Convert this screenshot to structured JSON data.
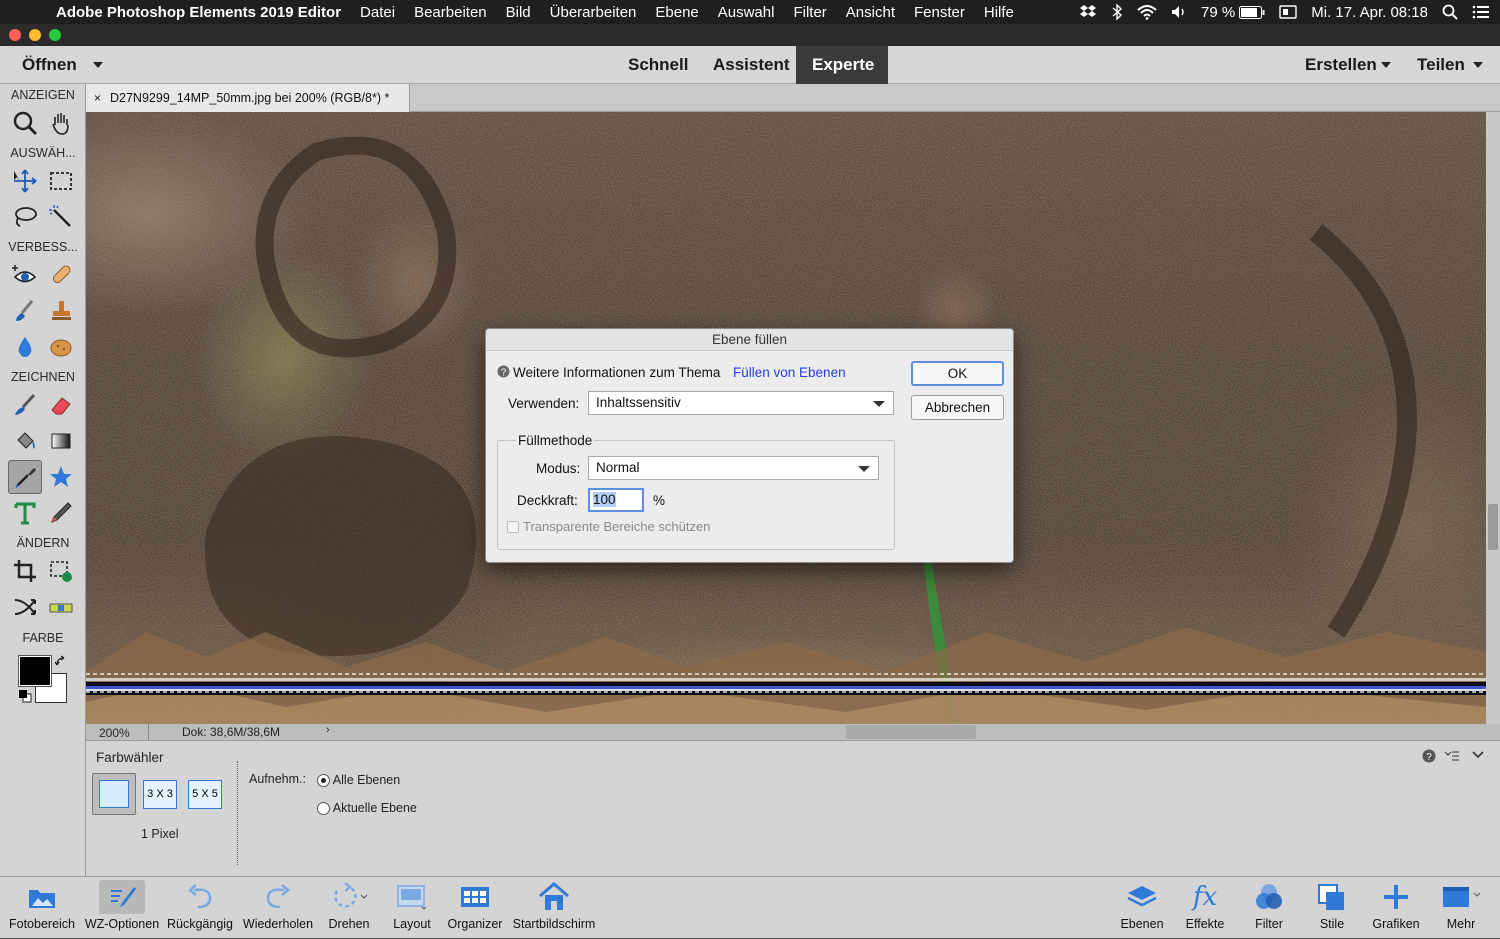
{
  "menubar": {
    "app_name": "Adobe Photoshop Elements 2019 Editor",
    "items": [
      "Datei",
      "Bearbeiten",
      "Bild",
      "Überarbeiten",
      "Ebene",
      "Auswahl",
      "Filter",
      "Ansicht",
      "Fenster",
      "Hilfe"
    ],
    "battery": "79 %",
    "datetime": "Mi. 17. Apr.  08:18"
  },
  "modebar": {
    "open": "Öffnen",
    "modes": [
      "Schnell",
      "Assistent",
      "Experte"
    ],
    "active_mode": "Experte",
    "create": "Erstellen",
    "share": "Teilen"
  },
  "toolbox": {
    "sections": [
      "ANZEIGEN",
      "AUSWÄH...",
      "VERBESS...",
      "ZEICHNEN",
      "ÄNDERN",
      "FARBE"
    ],
    "selected_tool": "eyedropper-icon"
  },
  "document": {
    "tab_title": "D27N9299_14MP_50mm.jpg bei 200% (RGB/8*) *",
    "zoom": "200%",
    "doc_size": "Dok: 38,6M/38,6M"
  },
  "dialog": {
    "title": "Ebene füllen",
    "info_text": "Weitere Informationen zum Thema",
    "info_link": "Füllen von Ebenen",
    "use_label": "Verwenden:",
    "use_value": "Inhaltssensitiv",
    "group_title": "Füllmethode",
    "mode_label": "Modus:",
    "mode_value": "Normal",
    "opacity_label": "Deckkraft:",
    "opacity_value": "100",
    "opacity_unit": "%",
    "preserve_label": "Transparente Bereiche schützen",
    "ok": "OK",
    "cancel": "Abbrechen"
  },
  "options": {
    "title": "Farbwähler",
    "sample_sizes": [
      "3 X 3",
      "5 X 5"
    ],
    "sample_caption": "1 Pixel",
    "sample_from_label": "Aufnehm.:",
    "radio_all": "Alle Ebenen",
    "radio_current": "Aktuelle Ebene"
  },
  "bottombar": {
    "left": [
      "Fotobereich",
      "WZ-Optionen",
      "Rückgängig",
      "Wiederholen",
      "Drehen",
      "Layout",
      "Organizer",
      "Startbildschirm"
    ],
    "right": [
      "Ebenen",
      "Effekte",
      "Filter",
      "Stile",
      "Grafiken",
      "Mehr"
    ]
  },
  "colors": {
    "accent": "#2f6fd9",
    "link": "#2a3fd6",
    "foreground_color": "#000000",
    "background_color": "#ffffff"
  }
}
